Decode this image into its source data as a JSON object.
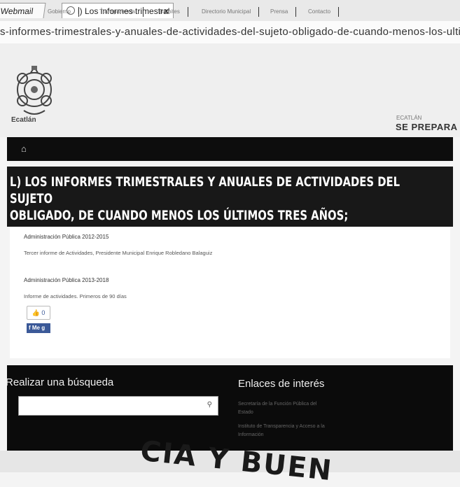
{
  "browser": {
    "tabs": [
      {
        "label": "Webmail"
      },
      {
        "label": "l) Los informes trimestral",
        "close": "×"
      }
    ],
    "url": "s-informes-trimestrales-y-anuales-de-actividades-del-sujeto-obligado-de-cuando-menos-los-ultimos"
  },
  "header": {
    "logo_caption": "Ecatlán",
    "brand_small": "ECATLÁN",
    "brand": "SE PREPARA"
  },
  "nav": {
    "home_icon": "home-icon",
    "items": [
      "Gobierno",
      "Transparencia",
      "Trámites",
      "Directorio Municipal",
      "Prensa",
      "Contacto"
    ]
  },
  "page": {
    "title_line1": "L) LOS INFORMES TRIMESTRALES Y ANUALES DE ACTIVIDADES DEL SUJETO",
    "title_line2": "OBLIGADO, DE CUANDO MENOS LOS ÚLTIMOS TRES AÑOS;"
  },
  "sections": [
    {
      "heading": "Administración Pública 2012-2015",
      "link": "Tercer informe de Actividades, Presidente Municipal Enrique Robledano Balaguiz"
    },
    {
      "heading": "Administración Pública 2013-2018",
      "link": "Informe de actividades. Primeros de 90 días"
    }
  ],
  "social": {
    "like_label": "0",
    "share_label": "Me g"
  },
  "footer": {
    "search_heading": "Realizar una búsqueda",
    "search_placeholder": "",
    "links_heading": "Enlaces de interés",
    "links": [
      "Secretaría de la Función Pública del Estado",
      "Instituto de Transparencia y Acceso a la Información"
    ]
  },
  "background_stamp": "CIA Y BUEN"
}
